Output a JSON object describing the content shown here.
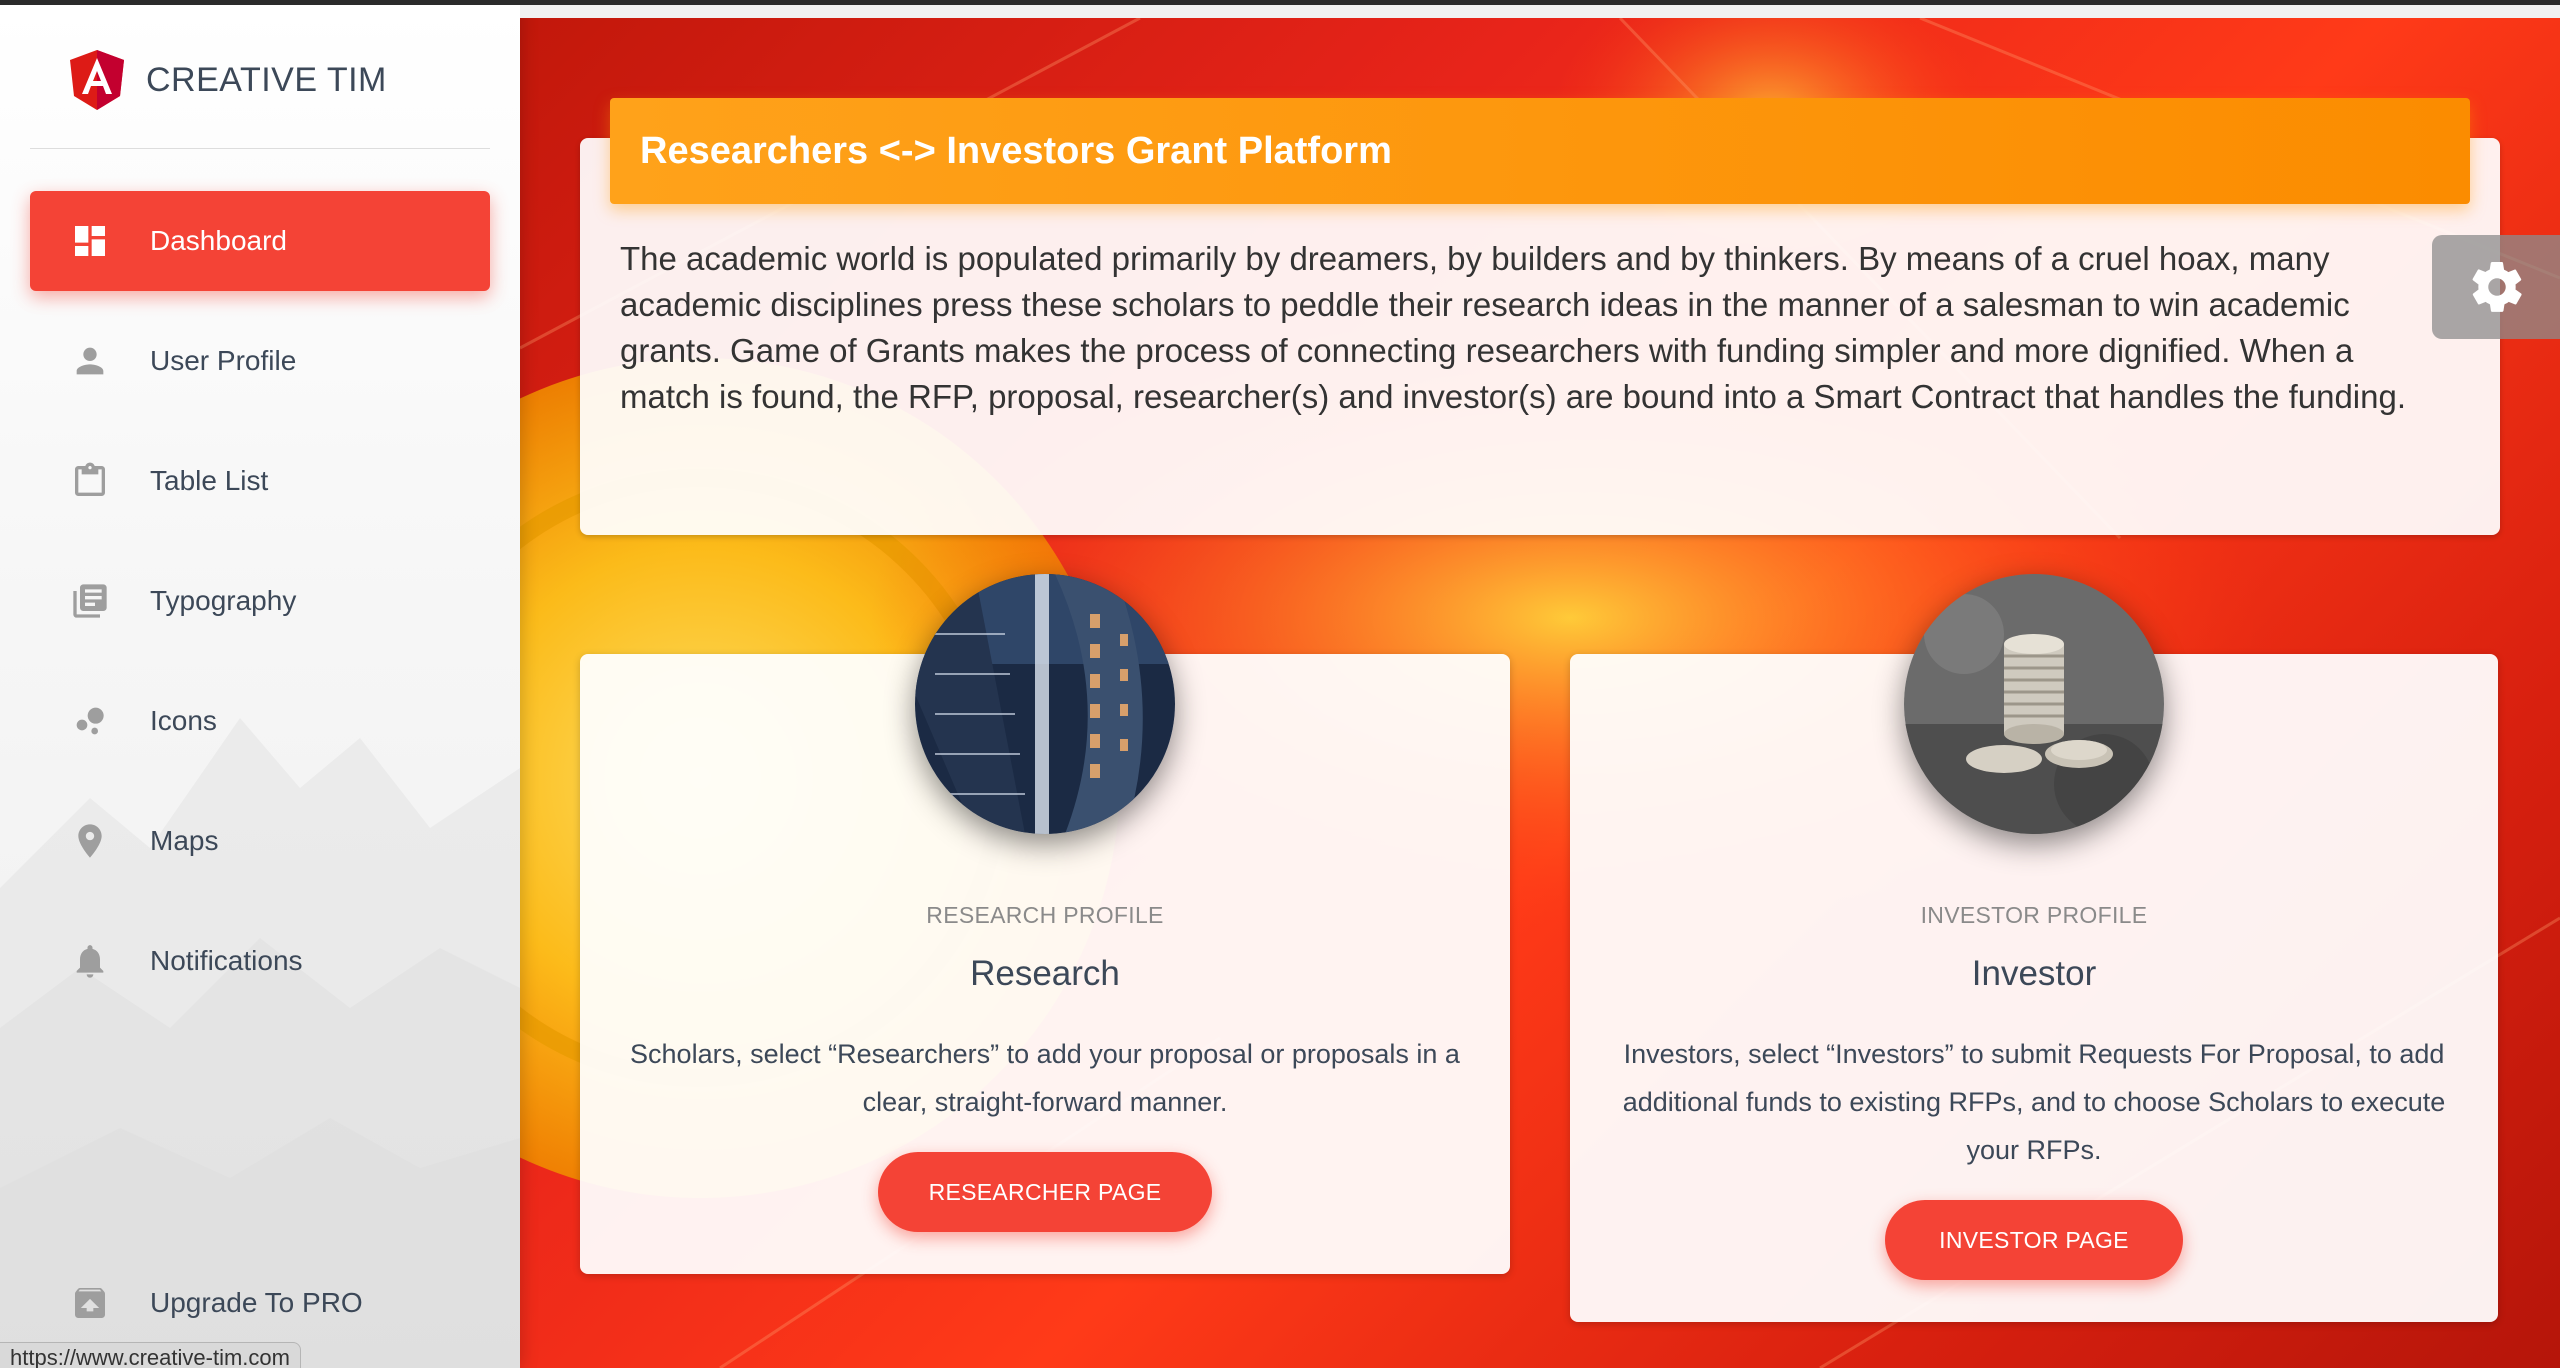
{
  "brand": {
    "name": "CREATIVE TIM"
  },
  "sidebar": {
    "items": [
      {
        "label": "Dashboard",
        "icon": "dashboard-icon",
        "active": true
      },
      {
        "label": "User Profile",
        "icon": "person-icon",
        "active": false
      },
      {
        "label": "Table List",
        "icon": "clipboard-icon",
        "active": false
      },
      {
        "label": "Typography",
        "icon": "library-books-icon",
        "active": false
      },
      {
        "label": "Icons",
        "icon": "bubble-chart-icon",
        "active": false
      },
      {
        "label": "Maps",
        "icon": "location-pin-icon",
        "active": false
      },
      {
        "label": "Notifications",
        "icon": "bell-icon",
        "active": false
      }
    ],
    "upgrade": {
      "label": "Upgrade To PRO",
      "icon": "unarchive-icon"
    }
  },
  "status_url": "https://www.creative-tim.com",
  "header": {
    "title": "Researchers <-> Investors Grant Platform",
    "description": "The academic world is populated primarily by dreamers, by builders and by thinkers. By means of a cruel hoax, many academic disciplines press these scholars to peddle their research ideas in the manner of a salesman to win academic grants. Game of Grants makes the process of connecting researchers with funding simpler and more dignified. When a match is found, the RFP, proposal, researcher(s) and investor(s) are bound into a Smart Contract that handles the funding."
  },
  "cards": {
    "research": {
      "category": "RESEARCH PROFILE",
      "title": "Research",
      "description": "Scholars, select “Researchers” to add your proposal or proposals in a clear, straight-forward manner.",
      "button": "RESEARCHER PAGE"
    },
    "investor": {
      "category": "INVESTOR PROFILE",
      "title": "Investor",
      "description": "Investors, select “Investors” to submit Requests For Proposal, to add additional funds to existing RFPs, and to choose Scholars to execute your RFPs.",
      "button": "INVESTOR PAGE"
    }
  },
  "colors": {
    "accent": "#f44336",
    "header_bar": "#fb8c00",
    "text_dark": "#3c4858"
  }
}
